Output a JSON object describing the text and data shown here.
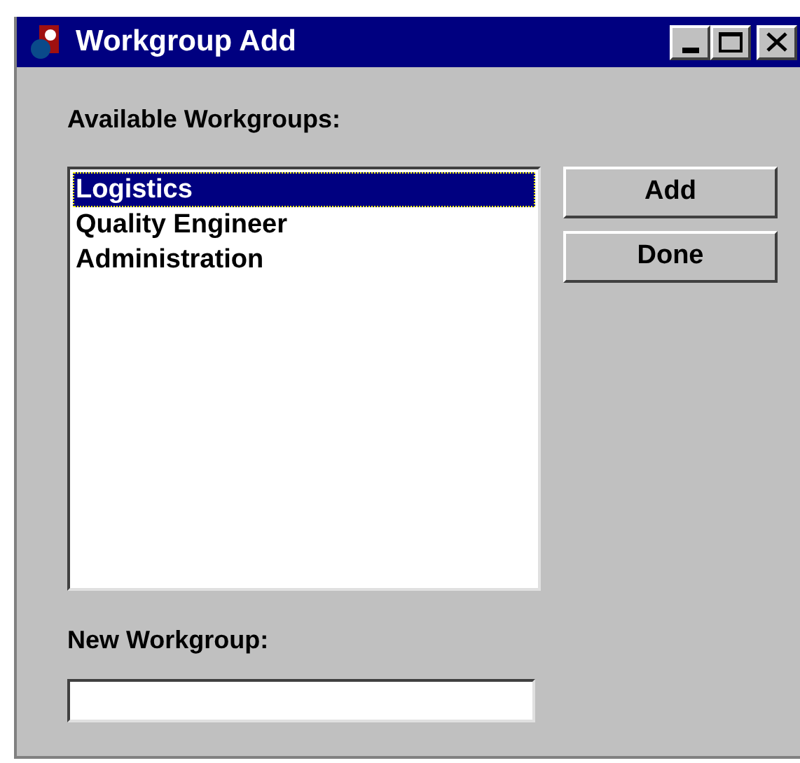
{
  "window": {
    "title": "Workgroup Add"
  },
  "available_label": "Available Workgroups:",
  "workgroups": [
    {
      "label": "Logistics",
      "selected": true
    },
    {
      "label": "Quality Engineer",
      "selected": false
    },
    {
      "label": "Administration",
      "selected": false
    }
  ],
  "buttons": [
    "Add",
    "Done"
  ],
  "new_workgroup": {
    "label": "New Workgroup:"
  }
}
